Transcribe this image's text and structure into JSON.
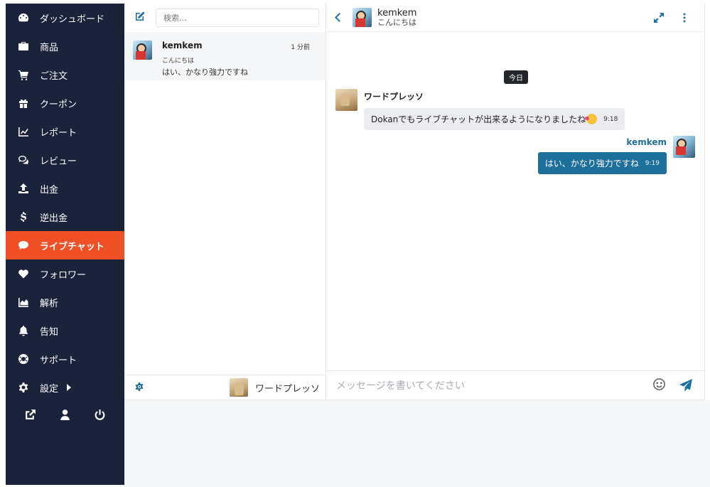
{
  "sidebar": {
    "items": [
      {
        "label": "ダッシュボード",
        "icon": "dashboard-icon"
      },
      {
        "label": "商品",
        "icon": "briefcase-icon"
      },
      {
        "label": "ご注文",
        "icon": "cart-icon"
      },
      {
        "label": "クーポン",
        "icon": "gift-icon"
      },
      {
        "label": "レポート",
        "icon": "chart-line-icon"
      },
      {
        "label": "レビュー",
        "icon": "comments-icon"
      },
      {
        "label": "出金",
        "icon": "upload-icon"
      },
      {
        "label": "逆出金",
        "icon": "dollar-icon"
      },
      {
        "label": "ライブチャット",
        "icon": "chat-bubble-icon",
        "active": true
      },
      {
        "label": "フォロワー",
        "icon": "heart-icon"
      },
      {
        "label": "解析",
        "icon": "area-chart-icon"
      },
      {
        "label": "告知",
        "icon": "bell-icon"
      },
      {
        "label": "サポート",
        "icon": "lifebuoy-icon"
      },
      {
        "label": "設定",
        "icon": "gear-icon"
      }
    ],
    "footer_icons": [
      "external-link-icon",
      "user-icon",
      "power-icon"
    ]
  },
  "conversations": {
    "search_placeholder": "検索...",
    "items": [
      {
        "name": "kemkem",
        "time": "1 分前",
        "subtitle": "こんにちは",
        "last_message": "はい、かなり強力ですね"
      }
    ],
    "current_user": "ワードプレッソ"
  },
  "chat": {
    "header": {
      "name": "kemkem",
      "status": "こんにちは"
    },
    "day_label": "今日",
    "messages": [
      {
        "sender": "ワードプレッソ",
        "text": "Dokanでもライブチャットが出来るようになりましたね",
        "time": "9:18",
        "direction": "incoming"
      },
      {
        "sender": "kemkem",
        "text": "はい、かなり強力ですね",
        "time": "9:19",
        "direction": "outgoing"
      }
    ],
    "composer_placeholder": "メッセージを書いてください"
  },
  "colors": {
    "sidebar_bg": "#1b233b",
    "active": "#f05025",
    "accent": "#1f6f9b"
  }
}
